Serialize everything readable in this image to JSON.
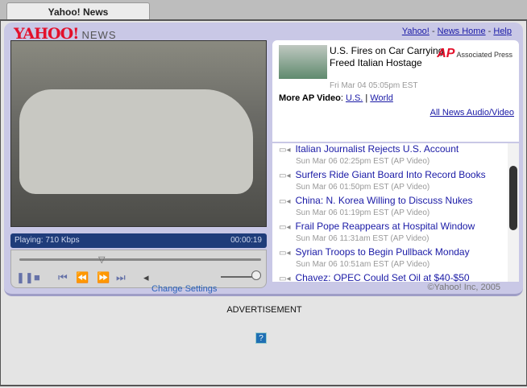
{
  "tab": {
    "title": "Yahoo! News"
  },
  "header": {
    "logo": "YAHOO!",
    "section": "NEWS",
    "links": [
      "Yahoo!",
      "News Home",
      "Help"
    ],
    "sep": "-"
  },
  "player": {
    "status": "Playing: 710 Kbps",
    "time": "00:00:19",
    "seek_percent": 37,
    "volume_percent": 100,
    "change_settings": "Change Settings"
  },
  "featured": {
    "title": "U.S. Fires on Car Carrying Freed Italian Hostage",
    "date": "Fri Mar 04 05:05pm EST",
    "source": "Associated Press",
    "source_logo": "AP",
    "more_label": "More AP Video",
    "more_links": [
      "U.S.",
      "World"
    ],
    "all_link": "All News Audio/Video"
  },
  "list": [
    {
      "title": "Italian Journalist Rejects U.S. Account",
      "date": "Sun Mar 06 02:25pm EST (AP Video)"
    },
    {
      "title": "Surfers Ride Giant Board Into Record Books",
      "date": "Sun Mar 06 01:50pm EST (AP Video)"
    },
    {
      "title": "China: N. Korea Willing to Discuss Nukes",
      "date": "Sun Mar 06 01:19pm EST (AP Video)"
    },
    {
      "title": "Frail Pope Reappears at Hospital Window",
      "date": "Sun Mar 06 11:31am EST (AP Video)"
    },
    {
      "title": "Syrian Troops to Begin Pullback Monday",
      "date": "Sun Mar 06 10:51am EST (AP Video)"
    },
    {
      "title": "Chavez: OPEC Could Set Oil at $40-$50",
      "date": ""
    }
  ],
  "copyright": "©Yahoo! Inc, 2005",
  "ad": {
    "label": "ADVERTISEMENT",
    "icon": "?"
  }
}
